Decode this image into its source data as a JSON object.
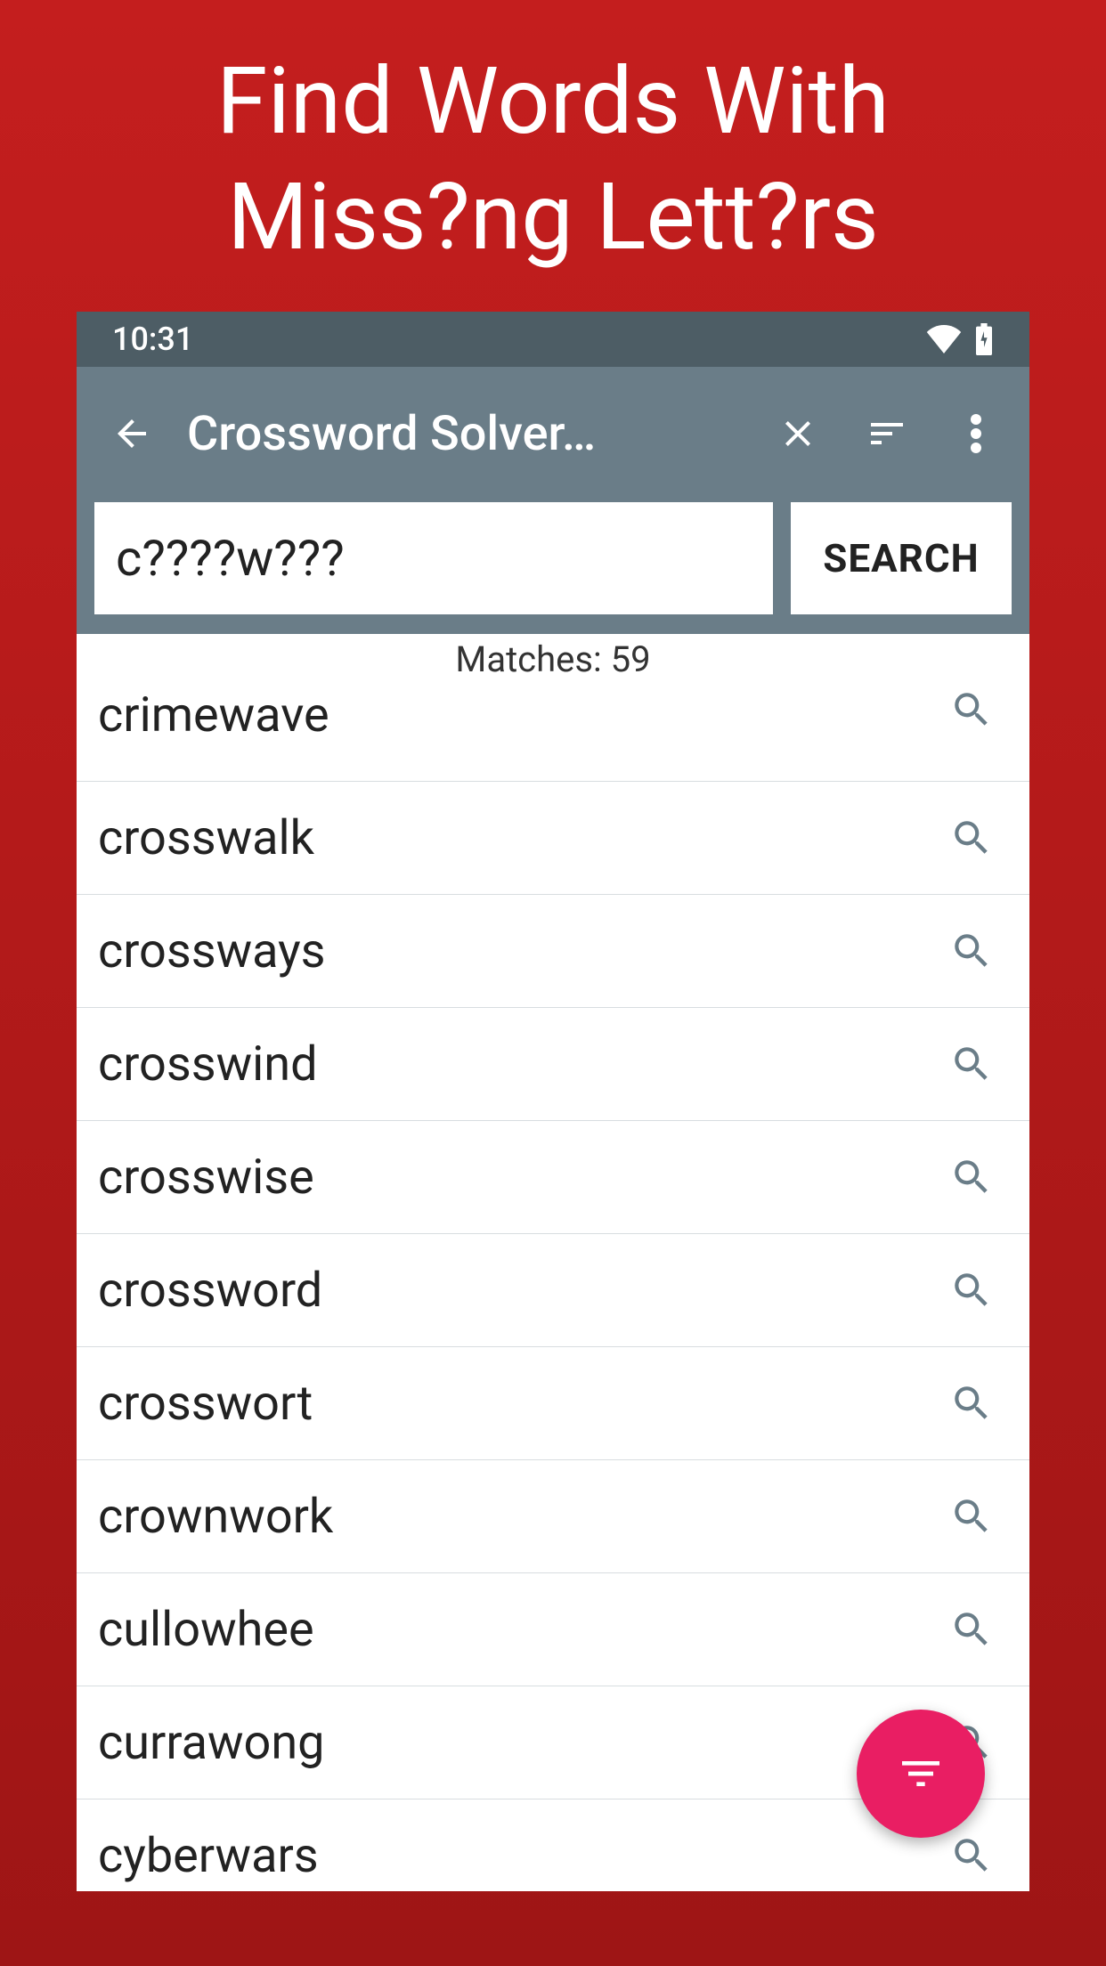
{
  "promo": {
    "line1": "Find Words With",
    "line2": "Miss?ng Lett?rs"
  },
  "status": {
    "time": "10:31"
  },
  "app": {
    "title": "Crossword Solver…"
  },
  "search": {
    "value": "c????w???",
    "button": "SEARCH"
  },
  "matches": {
    "label": "Matches: 59"
  },
  "results": [
    {
      "word": "crimewave"
    },
    {
      "word": "crosswalk"
    },
    {
      "word": "crossways"
    },
    {
      "word": "crosswind"
    },
    {
      "word": "crosswise"
    },
    {
      "word": "crossword"
    },
    {
      "word": "crosswort"
    },
    {
      "word": "crownwork"
    },
    {
      "word": "cullowhee"
    },
    {
      "word": "currawong"
    },
    {
      "word": "cyberwars"
    }
  ]
}
